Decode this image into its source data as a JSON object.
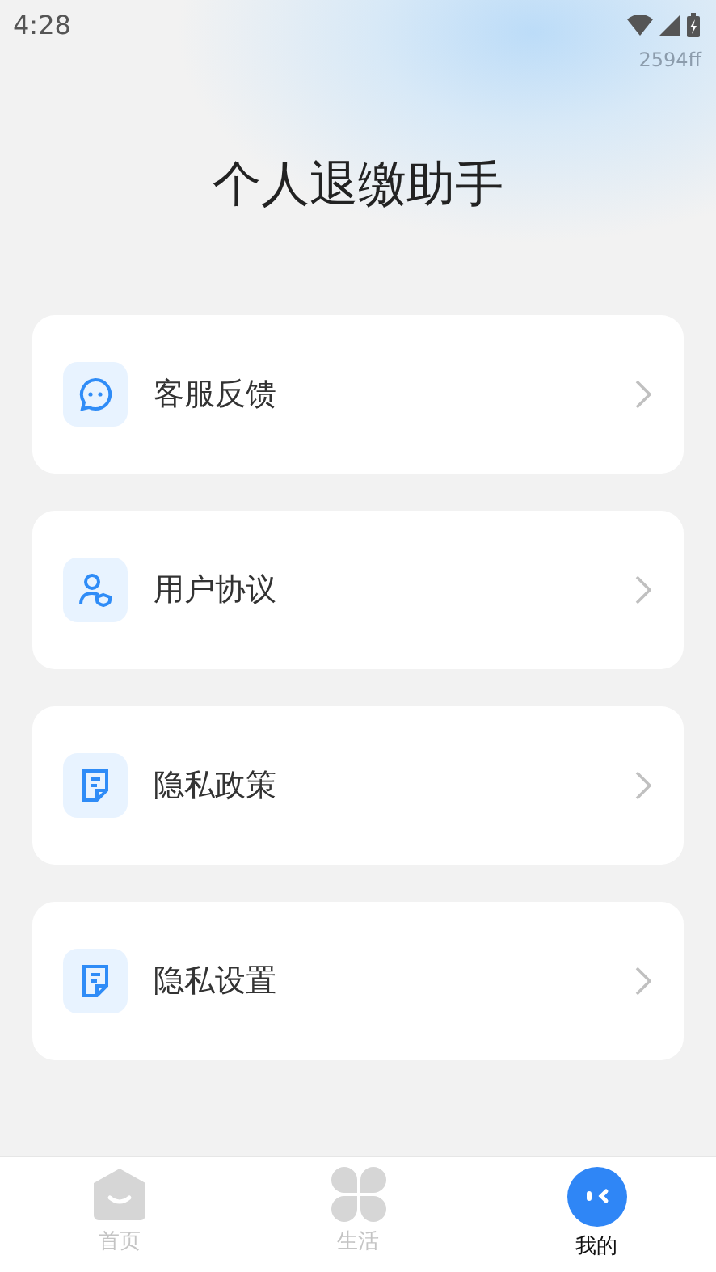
{
  "status_bar": {
    "time": "4:28"
  },
  "color_hint": "2594ff",
  "title": "个人退缴助手",
  "menu": [
    {
      "label": "客服反馈",
      "kind": "chat"
    },
    {
      "label": "用户协议",
      "kind": "user"
    },
    {
      "label": "隐私政策",
      "kind": "doc"
    },
    {
      "label": "隐私设置",
      "kind": "doc"
    }
  ],
  "tabs": [
    {
      "label": "首页",
      "kind": "home",
      "selected": false
    },
    {
      "label": "生活",
      "kind": "clover",
      "selected": false
    },
    {
      "label": "我的",
      "kind": "face",
      "selected": true
    }
  ]
}
